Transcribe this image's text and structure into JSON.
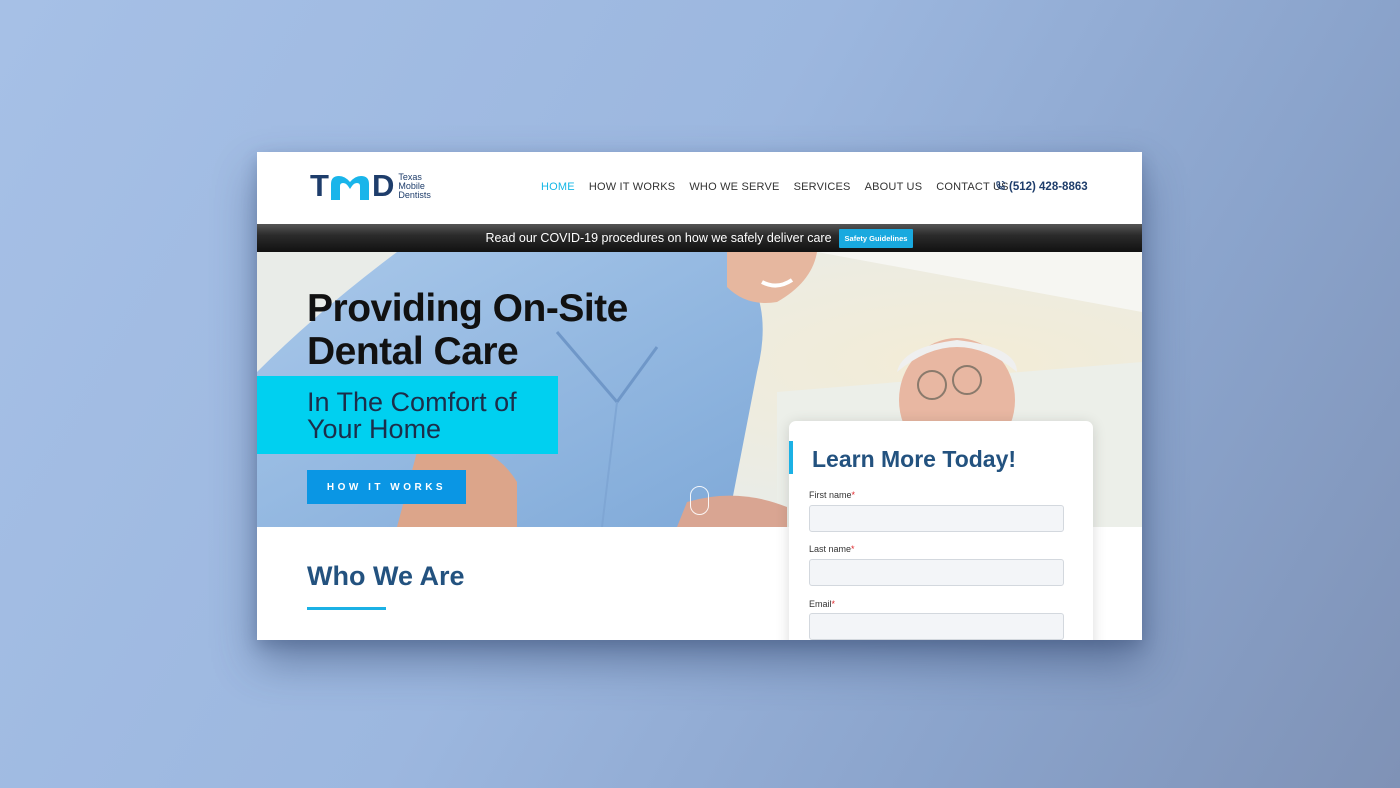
{
  "brand": {
    "logo_letters": {
      "t": "T",
      "d": "D"
    },
    "logo_text_lines": [
      "Texas",
      "Mobile",
      "Dentists"
    ]
  },
  "nav": {
    "items": [
      {
        "label": "HOME",
        "active": true
      },
      {
        "label": "HOW IT WORKS",
        "active": false
      },
      {
        "label": "WHO WE SERVE",
        "active": false
      },
      {
        "label": "SERVICES",
        "active": false
      },
      {
        "label": "ABOUT US",
        "active": false
      },
      {
        "label": "CONTACT US",
        "active": false
      }
    ],
    "phone": "(512) 428-8863"
  },
  "covid_bar": {
    "text": "Read our COVID-19 procedures on how we safely deliver care",
    "button": "Safety Guidelines"
  },
  "hero": {
    "title_line1": "Providing On-Site",
    "title_line2": "Dental Care",
    "subtitle_line1": "In The Comfort of",
    "subtitle_line2": "Your Home",
    "button": "HOW IT WORKS"
  },
  "who": {
    "title": "Who We Are"
  },
  "form": {
    "title": "Learn More Today!",
    "fields": [
      {
        "label": "First name",
        "required_mark": "*",
        "value": ""
      },
      {
        "label": "Last name",
        "required_mark": "*",
        "value": ""
      },
      {
        "label": "Email",
        "required_mark": "*",
        "value": ""
      }
    ]
  },
  "colors": {
    "navy": "#1e3d6b",
    "accent_cyan": "#00d0f0",
    "button_blue": "#0a96e4",
    "heading_blue": "#23527f",
    "active_nav": "#15b7e6"
  },
  "icons": {
    "phone": "phone-ring-icon",
    "scroll": "scroll-mouse-icon"
  }
}
